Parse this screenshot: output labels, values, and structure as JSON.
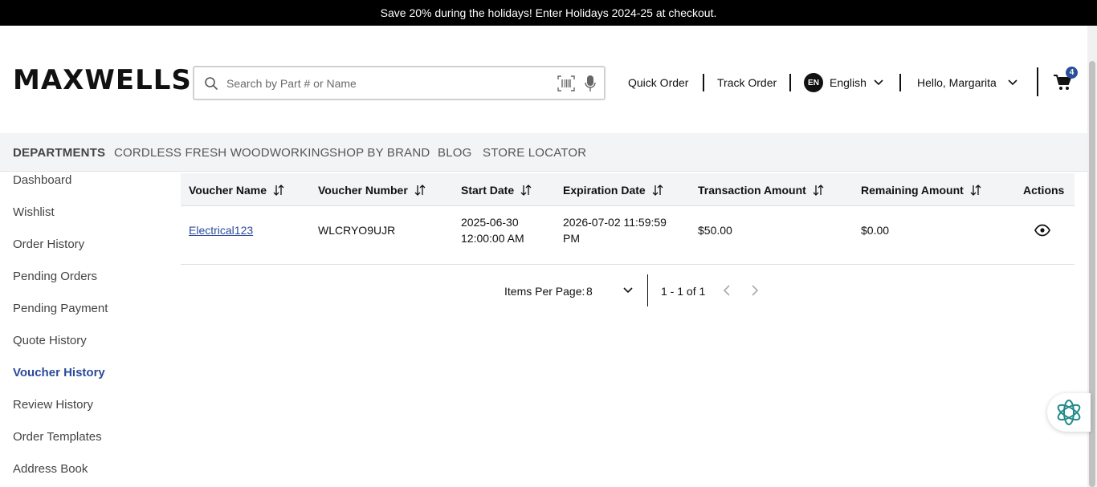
{
  "promo": {
    "text": "Save 20% during the holidays! Enter Holidays 2024-25 at checkout."
  },
  "header": {
    "logo": "MAXWELLS",
    "search_placeholder": "Search by Part # or Name",
    "quick_order": "Quick Order",
    "track_order": "Track Order",
    "lang_badge": "EN",
    "language": "English",
    "greeting": "Hello, Margarita",
    "cart_count": "4"
  },
  "menu": {
    "departments": "DEPARTMENTS",
    "items": [
      "CORDLESS FRESH WOODWORKING",
      "SHOP BY BRAND",
      "BLOG",
      "STORE LOCATOR"
    ]
  },
  "sidebar": {
    "items": [
      "Dashboard",
      "Wishlist",
      "Order History",
      "Pending Orders",
      "Pending Payment",
      "Quote History",
      "Voucher History",
      "Review History",
      "Order Templates",
      "Address Book"
    ],
    "active": "Voucher History"
  },
  "table": {
    "headers": [
      "Voucher Name",
      "Voucher Number",
      "Start Date",
      "Expiration Date",
      "Transaction Amount",
      "Remaining Amount",
      "Actions"
    ],
    "rows": [
      {
        "voucher_name": "Electrical123",
        "voucher_number": "WLCRYO9UJR",
        "start_date_line1": "2025-06-30",
        "start_date_line2": "12:00:00 AM",
        "expiration_line1": "2026-07-02 11:59:59",
        "expiration_line2": "PM",
        "transaction_amount": "$50.00",
        "remaining_amount": "$0.00"
      }
    ]
  },
  "pagination": {
    "items_per_page_label": "Items Per Page:",
    "items_per_page_value": "8",
    "range": "1 - 1 of 1"
  },
  "colors": {
    "accent": "#2a4a9a",
    "promo_bg": "#000000",
    "menubar_bg": "#f3f4f6",
    "ai_icon": "#1f8a8a"
  }
}
